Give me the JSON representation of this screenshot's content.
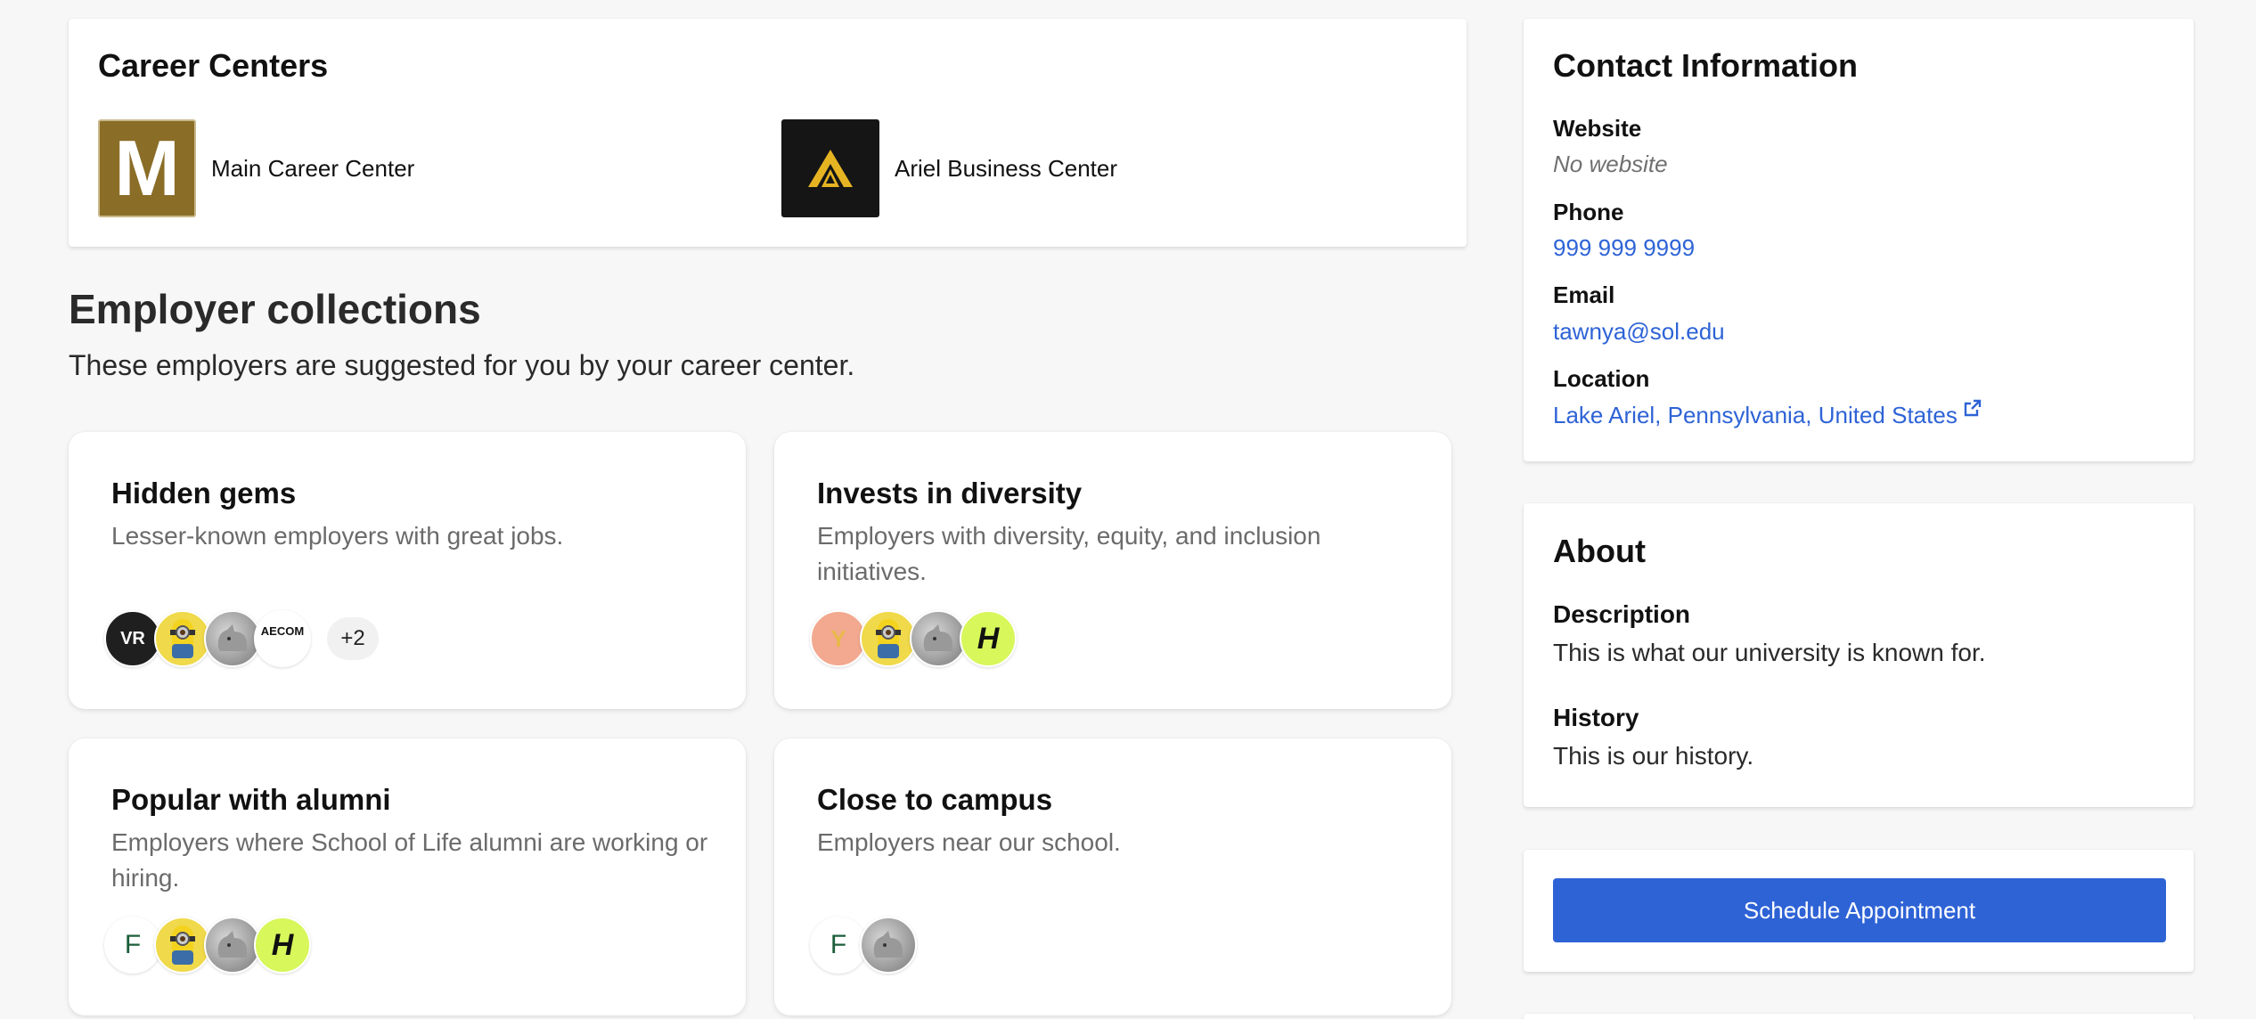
{
  "career_centers": {
    "title": "Career Centers",
    "items": [
      {
        "label": "Main Career Center",
        "logo_letter": "M",
        "logo_color": "#8a6d27"
      },
      {
        "label": "Ariel Business Center",
        "logo_color": "#151515",
        "accent": "#e6b422"
      }
    ]
  },
  "employer_collections": {
    "title": "Employer collections",
    "subtitle": "These employers are suggested for you by your career center.",
    "cards": [
      {
        "title": "Hidden gems",
        "description": "Lesser-known employers with great jobs.",
        "more": "+2",
        "avatar_texts": [
          "VR",
          "AECOM"
        ]
      },
      {
        "title": "Invests in diversity",
        "description": "Employers with diversity, equity, and inclusion initiatives.",
        "avatar_texts": [
          "Y",
          "H"
        ]
      },
      {
        "title": "Popular with alumni",
        "description": "Employers where School of Life alumni are working or hiring.",
        "avatar_texts": [
          "F",
          "H"
        ]
      },
      {
        "title": "Close to campus",
        "description": "Employers near our school.",
        "avatar_texts": [
          "F"
        ]
      }
    ]
  },
  "contact": {
    "title": "Contact Information",
    "website_label": "Website",
    "website_value": "No website",
    "phone_label": "Phone",
    "phone_value": "999 999 9999",
    "email_label": "Email",
    "email_value": "tawnya@sol.edu",
    "location_label": "Location",
    "location_value": "Lake Ariel, Pennsylvania, United States"
  },
  "about": {
    "title": "About",
    "description_label": "Description",
    "description_value": "This is what our university is known for.",
    "history_label": "History",
    "history_value": "This is our history."
  },
  "actions": {
    "schedule_label": "Schedule Appointment"
  },
  "colors": {
    "link": "#2e63d6",
    "primary_button": "#2e63d6",
    "background": "#f7f7f7"
  }
}
